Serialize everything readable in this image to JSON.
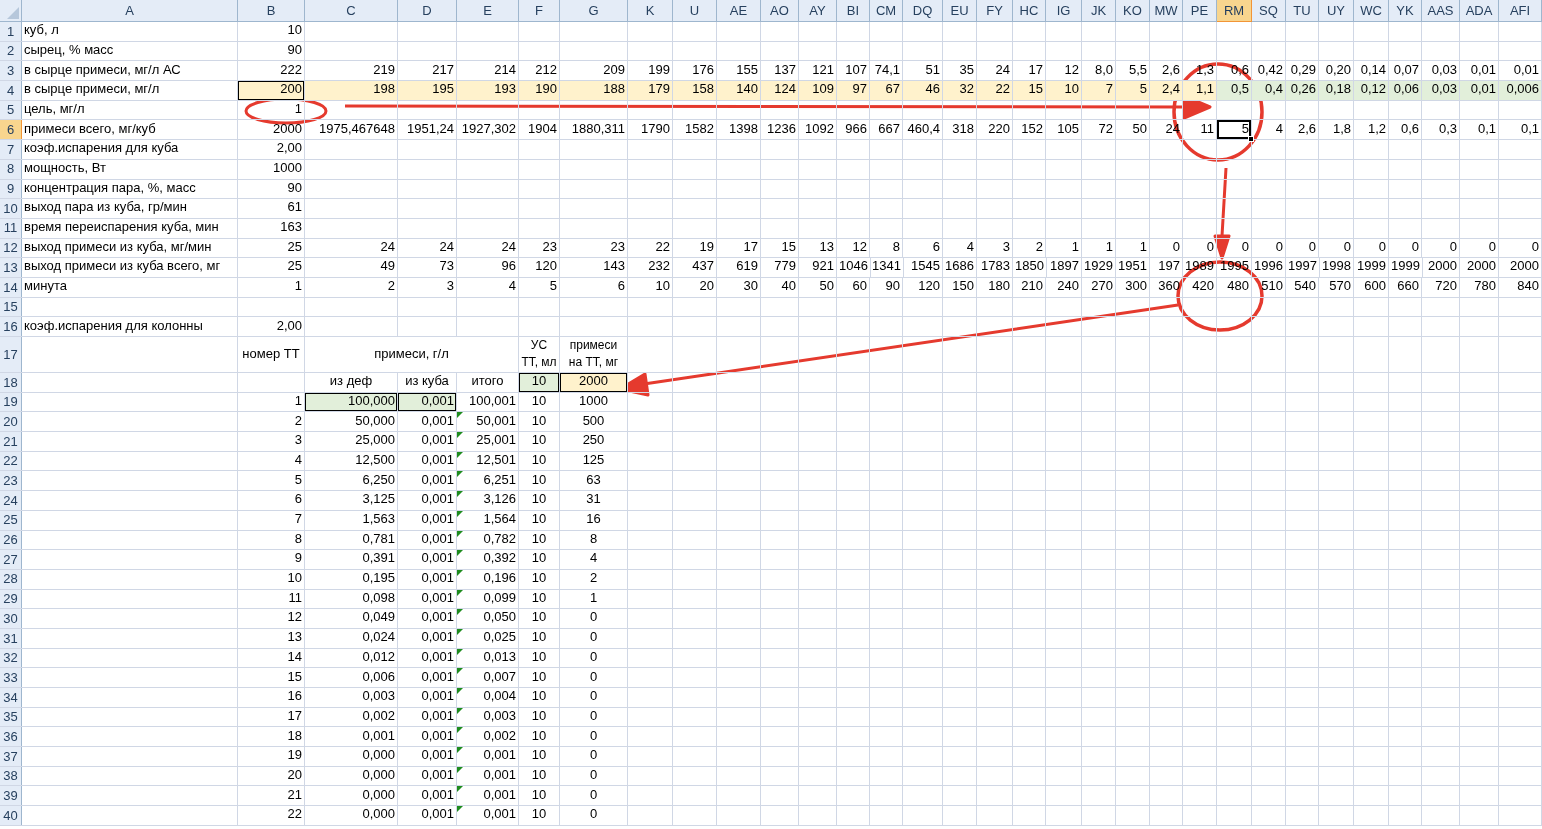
{
  "columns": [
    {
      "label": "A",
      "selected": false
    },
    {
      "label": "B",
      "selected": false
    },
    {
      "label": "C",
      "selected": false
    },
    {
      "label": "D",
      "selected": false
    },
    {
      "label": "E",
      "selected": false
    },
    {
      "label": "F",
      "selected": false
    },
    {
      "label": "G",
      "selected": false
    },
    {
      "label": "K",
      "selected": false
    },
    {
      "label": "U",
      "selected": false
    },
    {
      "label": "AE",
      "selected": false
    },
    {
      "label": "AO",
      "selected": false
    },
    {
      "label": "AY",
      "selected": false
    },
    {
      "label": "BI",
      "selected": false
    },
    {
      "label": "CM",
      "selected": false
    },
    {
      "label": "DQ",
      "selected": false
    },
    {
      "label": "EU",
      "selected": false
    },
    {
      "label": "FY",
      "selected": false
    },
    {
      "label": "HC",
      "selected": false
    },
    {
      "label": "IG",
      "selected": false
    },
    {
      "label": "JK",
      "selected": false
    },
    {
      "label": "KO",
      "selected": false
    },
    {
      "label": "MW",
      "selected": false
    },
    {
      "label": "PE",
      "selected": false
    },
    {
      "label": "RM",
      "selected": true
    },
    {
      "label": "SQ",
      "selected": false
    },
    {
      "label": "TU",
      "selected": false
    },
    {
      "label": "UY",
      "selected": false
    },
    {
      "label": "WC",
      "selected": false
    },
    {
      "label": "YK",
      "selected": false
    },
    {
      "label": "AAS",
      "selected": false
    },
    {
      "label": "ADA",
      "selected": false
    },
    {
      "label": "AFI",
      "selected": false
    }
  ],
  "rows": [
    {
      "number": "1",
      "selected": false,
      "cells": [
        "куб, л",
        "10"
      ]
    },
    {
      "number": "2",
      "selected": false,
      "cells": [
        "сырец, % масс",
        "90"
      ]
    },
    {
      "number": "3",
      "selected": false,
      "cells": [
        "в сырце примеси, мг/л АС",
        "222",
        "219",
        "217",
        "214",
        "212",
        "209",
        "199",
        "176",
        "155",
        "137",
        "121",
        "107",
        "74,1",
        "51",
        "35",
        "24",
        "17",
        "12",
        "8,0",
        "5,5",
        "2,6",
        "1,3",
        "0,6",
        "0,42",
        "0,29",
        "0,20",
        "0,14",
        "0,07",
        "0,03",
        "0,01",
        "0,01"
      ]
    },
    {
      "number": "4",
      "selected": false,
      "cells": [
        "в сырце примеси, мг/л",
        {
          "text": "200",
          "color": "#fff2cc",
          "bordered": true
        },
        {
          "text": "198",
          "color": "#fff2cc"
        },
        {
          "text": "195",
          "color": "#fff2cc"
        },
        {
          "text": "193",
          "color": "#fff2cc"
        },
        {
          "text": "190",
          "color": "#fff2cc"
        },
        {
          "text": "188",
          "color": "#fff2cc"
        },
        {
          "text": "179",
          "color": "#fff2cc"
        },
        {
          "text": "158",
          "color": "#fff2cc"
        },
        {
          "text": "140",
          "color": "#fff2cc"
        },
        {
          "text": "124",
          "color": "#fff2cc"
        },
        {
          "text": "109",
          "color": "#fff2cc"
        },
        {
          "text": "97",
          "color": "#fff2cc"
        },
        {
          "text": "67",
          "color": "#fff2cc"
        },
        {
          "text": "46",
          "color": "#fff2cc"
        },
        {
          "text": "32",
          "color": "#fff2cc"
        },
        {
          "text": "22",
          "color": "#fff2cc"
        },
        {
          "text": "15",
          "color": "#fff2cc"
        },
        {
          "text": "10",
          "color": "#fff2cc"
        },
        {
          "text": "7",
          "color": "#fff2cc"
        },
        {
          "text": "5",
          "color": "#fff2cc"
        },
        {
          "text": "2,4",
          "color": "#fff2cc"
        },
        {
          "text": "1,1",
          "color": "#fff2cc"
        },
        {
          "text": "0,5",
          "color": "#e2efda"
        },
        {
          "text": "0,4",
          "color": "#e2efda"
        },
        {
          "text": "0,26",
          "color": "#e2efda"
        },
        {
          "text": "0,18",
          "color": "#e2efda"
        },
        {
          "text": "0,12",
          "color": "#e2efda"
        },
        {
          "text": "0,06",
          "color": "#e2efda"
        },
        {
          "text": "0,03",
          "color": "#e2efda"
        },
        {
          "text": "0,01",
          "color": "#e2efda"
        },
        {
          "text": "0,006",
          "color": "#e2efda"
        }
      ]
    },
    {
      "number": "5",
      "selected": false,
      "cells": [
        "цель, мг/л",
        "1"
      ]
    },
    {
      "number": "6",
      "selected": true,
      "cells": [
        "примеси всего, мг/куб",
        "2000",
        "1975,467648",
        "1951,24",
        "1927,302",
        "1904",
        "1880,311",
        "1790",
        "1582",
        "1398",
        "1236",
        "1092",
        "966",
        "667",
        "460,4",
        "318",
        "220",
        "152",
        "105",
        "72",
        "50",
        "24",
        "11",
        {
          "text": "5",
          "selected": true
        },
        "4",
        "2,6",
        "1,8",
        "1,2",
        "0,6",
        "0,3",
        "0,1",
        "0,1"
      ]
    },
    {
      "number": "7",
      "selected": false,
      "cells": [
        "коэф.испарения для куба",
        "2,00"
      ]
    },
    {
      "number": "8",
      "selected": false,
      "cells": [
        "мощность, Вт",
        "1000"
      ]
    },
    {
      "number": "9",
      "selected": false,
      "cells": [
        "концентрация пара, %, масс",
        "90"
      ]
    },
    {
      "number": "10",
      "selected": false,
      "cells": [
        "выход пара из куба, гр/мин",
        "61"
      ]
    },
    {
      "number": "11",
      "selected": false,
      "cells": [
        "время переиспарения куба, мин",
        "163"
      ]
    },
    {
      "number": "12",
      "selected": false,
      "cells": [
        "выход примеси из куба, мг/мин",
        "25",
        "24",
        "24",
        "24",
        "23",
        "23",
        "22",
        "19",
        "17",
        "15",
        "13",
        "12",
        "8",
        "6",
        "4",
        "3",
        "2",
        "1",
        "1",
        "1",
        "0",
        "0",
        "0",
        "0",
        "0",
        "0",
        "0",
        "0",
        "0",
        "0",
        "0"
      ]
    },
    {
      "number": "13",
      "selected": false,
      "cells": [
        "выход примеси из куба всего, мг",
        "25",
        "49",
        "73",
        "96",
        "120",
        "143",
        "232",
        "437",
        "619",
        "779",
        "921",
        "1046",
        "1341",
        "1545",
        "1686",
        "1783",
        "1850",
        "1897",
        "1929",
        "1951",
        "197",
        "1989",
        "1995",
        "1996",
        "1997",
        "1998",
        "1999",
        "1999",
        "2000",
        "2000",
        "2000"
      ]
    },
    {
      "number": "14",
      "selected": false,
      "cells": [
        "минута",
        "1",
        "2",
        "3",
        "4",
        "5",
        "6",
        "10",
        "20",
        "30",
        "40",
        "50",
        "60",
        "90",
        "120",
        "150",
        "180",
        "210",
        "240",
        "270",
        "300",
        "360",
        "420",
        "480",
        "510",
        "540",
        "570",
        "600",
        "660",
        "720",
        "780",
        "840"
      ]
    },
    {
      "number": "15",
      "selected": false
    },
    {
      "number": "16",
      "selected": false,
      "cells": [
        "коэф.испарения для колонны",
        "2,00"
      ]
    },
    {
      "number": "17",
      "selected": false,
      "cells": [
        null,
        "номер ТТ",
        null,
        "примеси, г/л",
        null,
        "УС ТТ, мл",
        "примеси на ТТ, мг"
      ]
    },
    {
      "number": "18",
      "selected": false,
      "cells": [
        null,
        null,
        "из деф",
        "из куба",
        "итого",
        {
          "text": "10",
          "color": "#e2efda",
          "bordered": true
        },
        {
          "text": "2000",
          "color": "#fff2cc",
          "bordered": true
        }
      ]
    },
    {
      "number": "19",
      "selected": false,
      "cells": [
        null,
        "1",
        {
          "text": "100,000",
          "color": "#e2efda",
          "bordered": true
        },
        {
          "text": "0,001",
          "color": "#e2efda",
          "bordered": true
        },
        "100,001",
        "10",
        "1000"
      ]
    },
    {
      "number": "20",
      "selected": false,
      "cells": [
        null,
        "2",
        "50,000",
        "0,001",
        {
          "text": "50,001",
          "flagged": true
        },
        "10",
        "500"
      ]
    },
    {
      "number": "21",
      "selected": false,
      "cells": [
        null,
        "3",
        "25,000",
        "0,001",
        {
          "text": "25,001",
          "flagged": true
        },
        "10",
        "250"
      ]
    },
    {
      "number": "22",
      "selected": false,
      "cells": [
        null,
        "4",
        "12,500",
        "0,001",
        {
          "text": "12,501",
          "flagged": true
        },
        "10",
        "125"
      ]
    },
    {
      "number": "23",
      "selected": false,
      "cells": [
        null,
        "5",
        "6,250",
        "0,001",
        {
          "text": "6,251",
          "flagged": true
        },
        "10",
        "63"
      ]
    },
    {
      "number": "24",
      "selected": false,
      "cells": [
        null,
        "6",
        "3,125",
        "0,001",
        {
          "text": "3,126",
          "flagged": true
        },
        "10",
        "31"
      ]
    },
    {
      "number": "25",
      "selected": false,
      "cells": [
        null,
        "7",
        "1,563",
        "0,001",
        {
          "text": "1,564",
          "flagged": true
        },
        "10",
        "16"
      ]
    },
    {
      "number": "26",
      "selected": false,
      "cells": [
        null,
        "8",
        "0,781",
        "0,001",
        {
          "text": "0,782",
          "flagged": true
        },
        "10",
        "8"
      ]
    },
    {
      "number": "27",
      "selected": false,
      "cells": [
        null,
        "9",
        "0,391",
        "0,001",
        {
          "text": "0,392",
          "flagged": true
        },
        "10",
        "4"
      ]
    },
    {
      "number": "28",
      "selected": false,
      "cells": [
        null,
        "10",
        "0,195",
        "0,001",
        {
          "text": "0,196",
          "flagged": true
        },
        "10",
        "2"
      ]
    },
    {
      "number": "29",
      "selected": false,
      "cells": [
        null,
        "11",
        "0,098",
        "0,001",
        {
          "text": "0,099",
          "flagged": true
        },
        "10",
        "1"
      ]
    },
    {
      "number": "30",
      "selected": false,
      "cells": [
        null,
        "12",
        "0,049",
        "0,001",
        {
          "text": "0,050",
          "flagged": true
        },
        "10",
        "0"
      ]
    },
    {
      "number": "31",
      "selected": false,
      "cells": [
        null,
        "13",
        "0,024",
        "0,001",
        {
          "text": "0,025",
          "flagged": true
        },
        "10",
        "0"
      ]
    },
    {
      "number": "32",
      "selected": false,
      "cells": [
        null,
        "14",
        "0,012",
        "0,001",
        {
          "text": "0,013",
          "flagged": true
        },
        "10",
        "0"
      ]
    },
    {
      "number": "33",
      "selected": false,
      "cells": [
        null,
        "15",
        "0,006",
        "0,001",
        {
          "text": "0,007",
          "flagged": true
        },
        "10",
        "0"
      ]
    },
    {
      "number": "34",
      "selected": false,
      "cells": [
        null,
        "16",
        "0,003",
        "0,001",
        {
          "text": "0,004",
          "flagged": true
        },
        "10",
        "0"
      ]
    },
    {
      "number": "35",
      "selected": false,
      "cells": [
        null,
        "17",
        "0,002",
        "0,001",
        {
          "text": "0,003",
          "flagged": true
        },
        "10",
        "0"
      ]
    },
    {
      "number": "36",
      "selected": false,
      "cells": [
        null,
        "18",
        "0,001",
        "0,001",
        {
          "text": "0,002",
          "flagged": true
        },
        "10",
        "0"
      ]
    },
    {
      "number": "37",
      "selected": false,
      "cells": [
        null,
        "19",
        "0,000",
        "0,001",
        {
          "text": "0,001",
          "flagged": true
        },
        "10",
        "0"
      ]
    },
    {
      "number": "38",
      "selected": false,
      "cells": [
        null,
        "20",
        "0,000",
        "0,001",
        {
          "text": "0,001",
          "flagged": true
        },
        "10",
        "0"
      ]
    },
    {
      "number": "39",
      "selected": false,
      "cells": [
        null,
        "21",
        "0,000",
        "0,001",
        {
          "text": "0,001",
          "flagged": true
        },
        "10",
        "0"
      ]
    },
    {
      "number": "40",
      "selected": false,
      "cells": [
        null,
        "22",
        "0,000",
        "0,001",
        {
          "text": "0,001",
          "flagged": true
        },
        "10",
        "0"
      ]
    }
  ]
}
